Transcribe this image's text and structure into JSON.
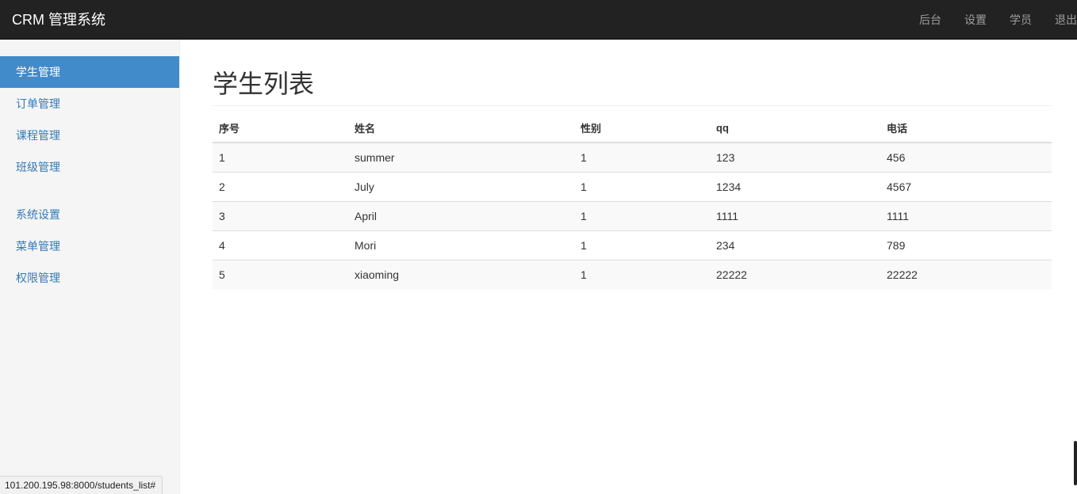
{
  "navbar": {
    "brand": "CRM 管理系统",
    "links": [
      "后台",
      "设置",
      "学员",
      "退出"
    ]
  },
  "sidebar": {
    "groups": [
      [
        "学生管理",
        "订单管理",
        "课程管理",
        "班级管理"
      ],
      [
        "系统设置",
        "菜单管理",
        "权限管理"
      ]
    ],
    "active": "学生管理"
  },
  "main": {
    "title": "学生列表",
    "table": {
      "headers": [
        "序号",
        "姓名",
        "性别",
        "qq",
        "电话"
      ],
      "rows": [
        [
          "1",
          "summer",
          "1",
          "123",
          "456"
        ],
        [
          "2",
          "July",
          "1",
          "1234",
          "4567"
        ],
        [
          "3",
          "April",
          "1",
          "1111",
          "1111"
        ],
        [
          "4",
          "Mori",
          "1",
          "234",
          "789"
        ],
        [
          "5",
          "xiaoming",
          "1",
          "22222",
          "22222"
        ]
      ]
    }
  },
  "status_url": "101.200.195.98:8000/students_list#",
  "colors": {
    "navbar_bg": "#222222",
    "active_bg": "#428bca",
    "link": "#337ab7"
  }
}
